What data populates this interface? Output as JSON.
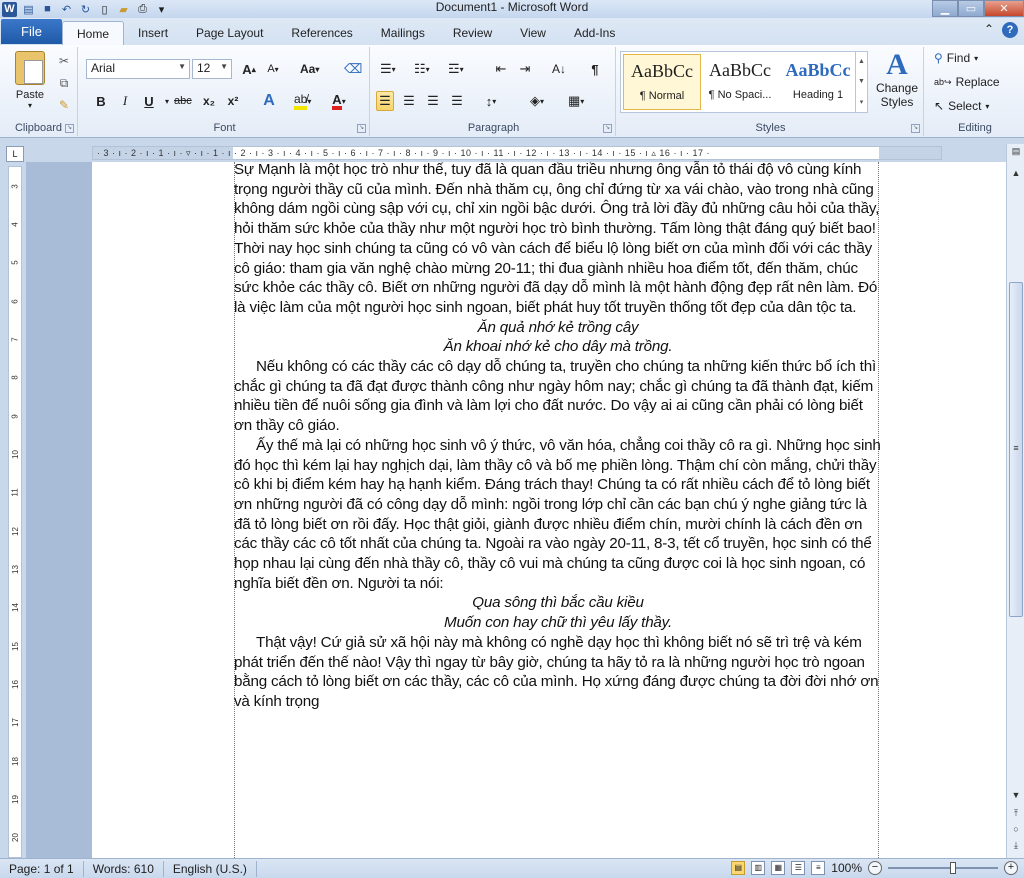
{
  "window": {
    "title": "Document1 - Microsoft Word"
  },
  "qat": {
    "icons": [
      "word-icon",
      "save-icon",
      "undo-icon",
      "redo-icon",
      "new-document-icon",
      "open-icon",
      "print-preview-icon",
      "customize-icon"
    ]
  },
  "tabs": {
    "file": "File",
    "items": [
      "Home",
      "Insert",
      "Page Layout",
      "References",
      "Mailings",
      "Review",
      "View",
      "Add-Ins"
    ],
    "active": "Home"
  },
  "clipboard": {
    "paste_label": "Paste",
    "group_label": "Clipboard"
  },
  "font": {
    "font_name": "Arial",
    "font_size": "12",
    "group_label": "Font",
    "bold": "B",
    "italic": "I",
    "underline": "U",
    "strikethrough": "abc",
    "subscript": "x₂",
    "superscript": "x²",
    "grow": "A",
    "shrink": "A",
    "change_case": "Aa",
    "font_color": "A",
    "font_color_hex": "#e02020",
    "highlight_hex": "#f2e600"
  },
  "paragraph": {
    "group_label": "Paragraph"
  },
  "styles": {
    "group_label": "Styles",
    "items": [
      {
        "preview": "AaBbCc",
        "name": "¶ Normal"
      },
      {
        "preview": "AaBbCc",
        "name": "¶ No Spaci..."
      },
      {
        "preview": "AaBbCc",
        "name": "Heading 1"
      }
    ],
    "change_styles": "Change Styles"
  },
  "editing": {
    "group_label": "Editing",
    "find": "Find",
    "replace": "Replace",
    "select": "Select"
  },
  "ruler": {
    "tab_selector": "L",
    "h_numbers": "· 3 · ı · 2 · ı · 1 · ı · ▿ · ı · 1 · ı · 2 · ı · 3 · ı · 4 · ı · 5 · ı · 6 · ı · 7 · ı · 8 · ı · 9 · ı · 10 · ı · 11 · ı · 12 · ı · 13 · ı · 14 · ı · 15 · ı ▵ 16 · ı · 17 ·",
    "v_numbers": [
      "3",
      "4",
      "5",
      "6",
      "7",
      "8",
      "9",
      "10",
      "11",
      "12",
      "13",
      "14",
      "15",
      "16",
      "17",
      "18",
      "19",
      "20"
    ]
  },
  "document": {
    "paragraphs": [
      {
        "style": "normal",
        "text": "Sự Mạnh là một học trò như thế, tuy đã là quan đầu triều nhưng ông vẫn tỏ thái độ vô cùng kính trọng người thầy cũ của mình. Đến nhà thăm cụ, ông chỉ đứng từ xa vái chào, vào trong nhà cũng không dám ngồi cùng sập với cụ, chỉ xin ngồi bậc dưới. Ông trả lời đầy đủ những câu hỏi của thầy, hỏi thăm sức khỏe của thầy như một người học trò bình thường. Tấm lòng thật đáng quý biết bao! Thời nay học sinh chúng ta cũng có vô vàn cách để biểu lộ lòng biết ơn của mình đối với các thầy cô giáo: tham gia văn nghệ chào mừng 20-11; thi đua giành nhiều hoa điểm tốt, đến thăm, chúc sức khỏe các thầy cô. Biết ơn những người đã dạy dỗ mình là một hành động đẹp rất nên làm. Đó là việc làm của một người học sinh ngoan, biết phát huy tốt truyền thống tốt đẹp của dân tộc ta."
      },
      {
        "style": "verse",
        "text": "Ăn quả nhớ kẻ trồng cây"
      },
      {
        "style": "verse",
        "text": "Ăn khoai nhớ kẻ cho dây mà trồng."
      },
      {
        "style": "indent",
        "text": "Nếu không có các thầy các cô dạy dỗ chúng ta, truyền cho chúng ta những kiến thức bổ ích thì chắc gì chúng ta đã đạt được thành công như ngày hôm nay; chắc gì chúng ta đã thành đạt, kiếm nhiều tiền để nuôi sống gia đình và làm lợi cho đất nước. Do vậy ai ai cũng cần phải có lòng biết ơn thầy cô giáo."
      },
      {
        "style": "indent",
        "text": "Ấy thế mà lại có những học sinh vô ý thức, vô văn hóa, chẳng coi thầy cô ra gì. Những học sinh đó học thì kém lại hay nghịch dại, làm thầy cô và bố mẹ phiền lòng. Thậm chí còn mắng, chửi thầy cô khi bị điểm kém hay hạ hạnh kiểm. Đáng trách thay! Chúng ta có rất nhiều cách để tỏ lòng biết ơn những người đã có công dạy dỗ mình: ngồi trong lớp chỉ cần các bạn chú ý nghe giảng tức là đã tỏ lòng biết ơn rồi đấy. Học thật giỏi, giành được nhiều điểm chín, mười chính là cách đền ơn các thầy các cô tốt nhất của chúng ta. Ngoài ra vào ngày 20-11, 8-3, tết cổ truyền, học sinh có thể họp nhau lại cùng đến nhà thầy cô, thầy cô vui mà chúng ta cũng được coi là học sinh ngoan, có nghĩa biết đền ơn. Người ta nói:"
      },
      {
        "style": "verse",
        "text": "Qua sông thì bắc cầu kiều"
      },
      {
        "style": "verse",
        "text": "Muốn con hay chữ thì yêu lấy thầy."
      },
      {
        "style": "indent",
        "text": "Thật vậy! Cứ giả sử xã hội này mà không có nghề dạy học thì không biết nó sẽ trì trệ và kém phát triển đến thế nào! Vậy thì ngay từ bây giờ, chúng ta hãy tỏ ra là những người học trò ngoan bằng cách tỏ lòng biết ơn các thầy, các cô của mình. Họ xứng đáng được chúng ta đời đời nhớ ơn và kính trọng"
      }
    ]
  },
  "status": {
    "page": "Page: 1 of 1",
    "words": "Words: 610",
    "language": "English (U.S.)",
    "zoom": "100%"
  },
  "colors": {
    "file_tab": "#2a5fb0",
    "accent": "#2f6bbd",
    "selected_button": "#f9d36b"
  }
}
